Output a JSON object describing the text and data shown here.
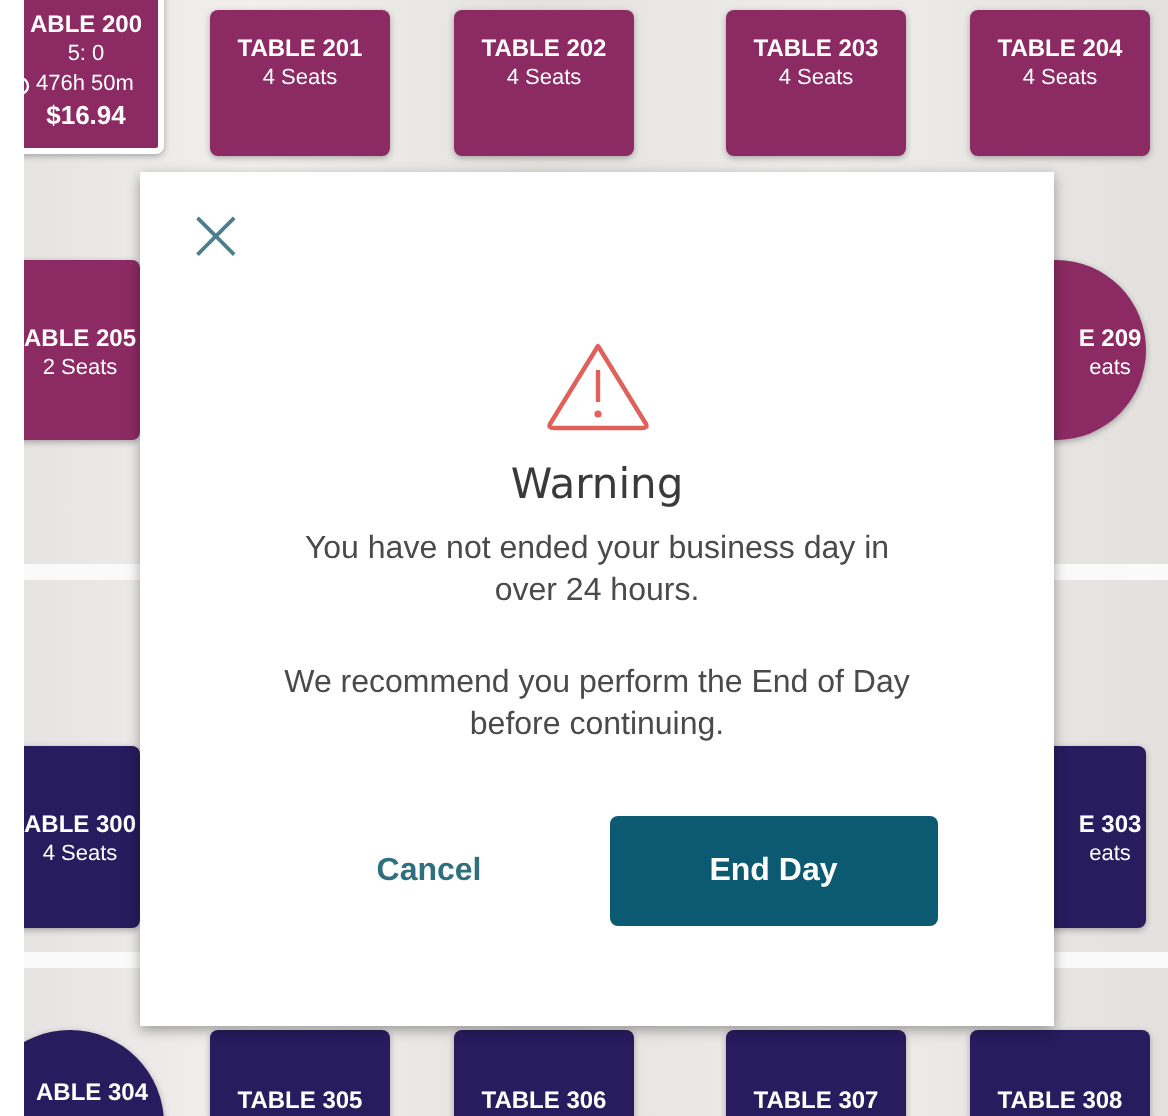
{
  "tables": [
    {
      "kind": "square",
      "label": "ABLE 200",
      "seats": "5: 0",
      "timer": "476h 50m",
      "amount": "$16.94",
      "color": "#8c2a63",
      "selected": true
    },
    {
      "kind": "square",
      "label": "TABLE 201",
      "seats": "4 Seats",
      "color": "#8c2a63",
      "selected": false
    },
    {
      "kind": "square",
      "label": "TABLE 202",
      "seats": "4 Seats",
      "color": "#8c2a63",
      "selected": false
    },
    {
      "kind": "square",
      "label": "TABLE 203",
      "seats": "4 Seats",
      "color": "#8c2a63",
      "selected": false
    },
    {
      "kind": "square",
      "label": "TABLE 204",
      "seats": "4 Seats",
      "color": "#8c2a63",
      "selected": false
    },
    {
      "kind": "square",
      "label": "ABLE 205",
      "seats": "2 Seats",
      "color": "#8c2a63",
      "selected": false
    },
    {
      "kind": "round",
      "label": "E 209",
      "seats": "eats",
      "color": "#8c2a63",
      "selected": false
    },
    {
      "kind": "square",
      "label": "ABLE 300",
      "seats": "4 Seats",
      "color": "#261c5e",
      "selected": false
    },
    {
      "kind": "square",
      "label": "E 303",
      "seats": "eats",
      "color": "#261c5e",
      "selected": false
    },
    {
      "kind": "round",
      "label": "ABLE 304",
      "color": "#261c5e",
      "selected": false
    },
    {
      "kind": "square",
      "label": "TABLE 305",
      "color": "#261c5e",
      "selected": false
    },
    {
      "kind": "square",
      "label": "TABLE 306",
      "color": "#261c5e",
      "selected": false
    },
    {
      "kind": "square",
      "label": "TABLE 307",
      "color": "#261c5e",
      "selected": false
    },
    {
      "kind": "square",
      "label": "TABLE 308",
      "color": "#261c5e",
      "selected": false
    }
  ],
  "dialog": {
    "close": "×",
    "title": "Warning",
    "paragraphs": [
      "You have not ended your business day in over 24 hours.",
      "We recommend you perform the End of Day before continuing."
    ],
    "buttons": [
      {
        "kind": "text",
        "label": "Cancel"
      },
      {
        "kind": "primary",
        "label": "End Day"
      }
    ]
  }
}
